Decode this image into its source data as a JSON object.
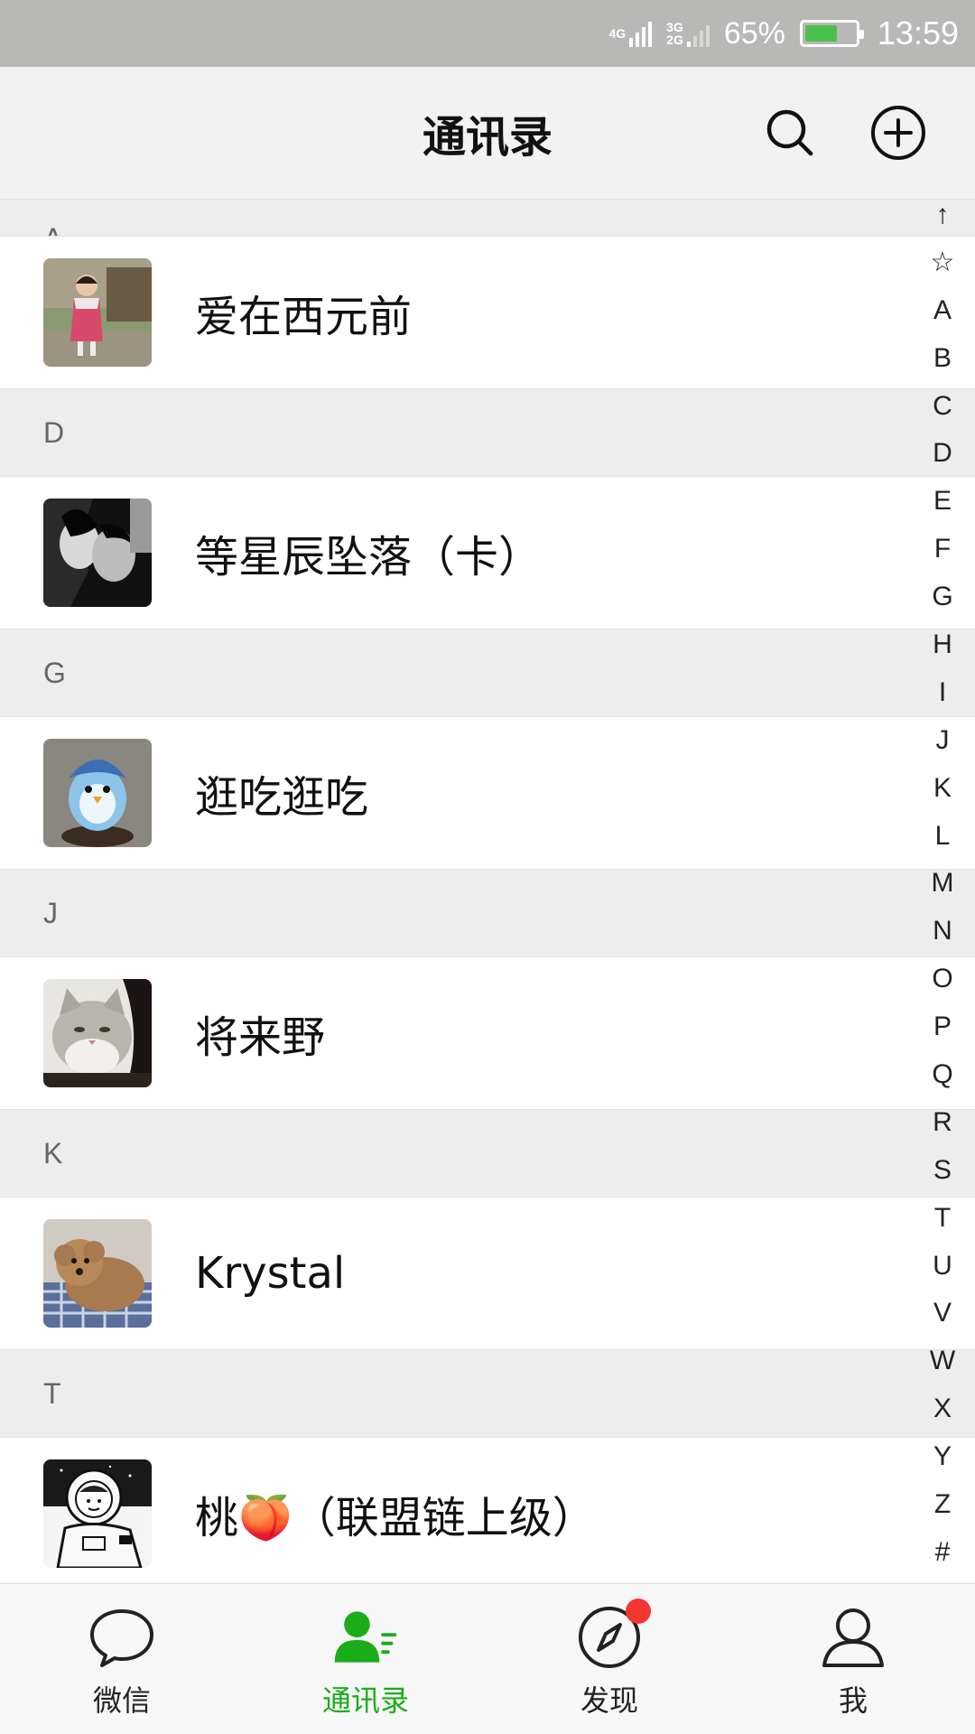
{
  "colors": {
    "accent": "#1aad19",
    "badge": "#f43530",
    "status_bar": "#b8b9b7",
    "header_bg": "#f2f2f2",
    "section_bg": "#ededed"
  },
  "status_bar": {
    "network_primary": "4G",
    "network_secondary_top": "3G",
    "network_secondary_bottom": "2G",
    "battery_percent": "65%",
    "battery_level": 0.65,
    "time": "13:59"
  },
  "header": {
    "title": "通讯录",
    "search_icon": "search-icon",
    "add_icon": "plus-circle-icon"
  },
  "contacts": {
    "partial_section": "A",
    "sections": [
      {
        "letter": "",
        "name": "爱在西元前",
        "avatar": "girl-photo"
      },
      {
        "letter": "D",
        "name": "等星辰坠落（卡）",
        "avatar": "couple-bw-photo"
      },
      {
        "letter": "G",
        "name": "逛吃逛吃",
        "avatar": "penguin-figure-photo"
      },
      {
        "letter": "J",
        "name": "将来野",
        "avatar": "cat-photo"
      },
      {
        "letter": "K",
        "name": "Krystal",
        "avatar": "poodle-photo"
      },
      {
        "letter": "T",
        "name": "桃🍑（联盟链上级）",
        "avatar": "astronaut-drawing"
      }
    ]
  },
  "index_bar": [
    "↑",
    "☆",
    "A",
    "B",
    "C",
    "D",
    "E",
    "F",
    "G",
    "H",
    "I",
    "J",
    "K",
    "L",
    "M",
    "N",
    "O",
    "P",
    "Q",
    "R",
    "S",
    "T",
    "U",
    "V",
    "W",
    "X",
    "Y",
    "Z",
    "#"
  ],
  "tabs": [
    {
      "label": "微信",
      "icon": "chat-bubble-icon",
      "active": false
    },
    {
      "label": "通讯录",
      "icon": "contacts-icon",
      "active": true
    },
    {
      "label": "发现",
      "icon": "compass-icon",
      "active": false,
      "badge": true
    },
    {
      "label": "我",
      "icon": "person-icon",
      "active": false
    }
  ]
}
